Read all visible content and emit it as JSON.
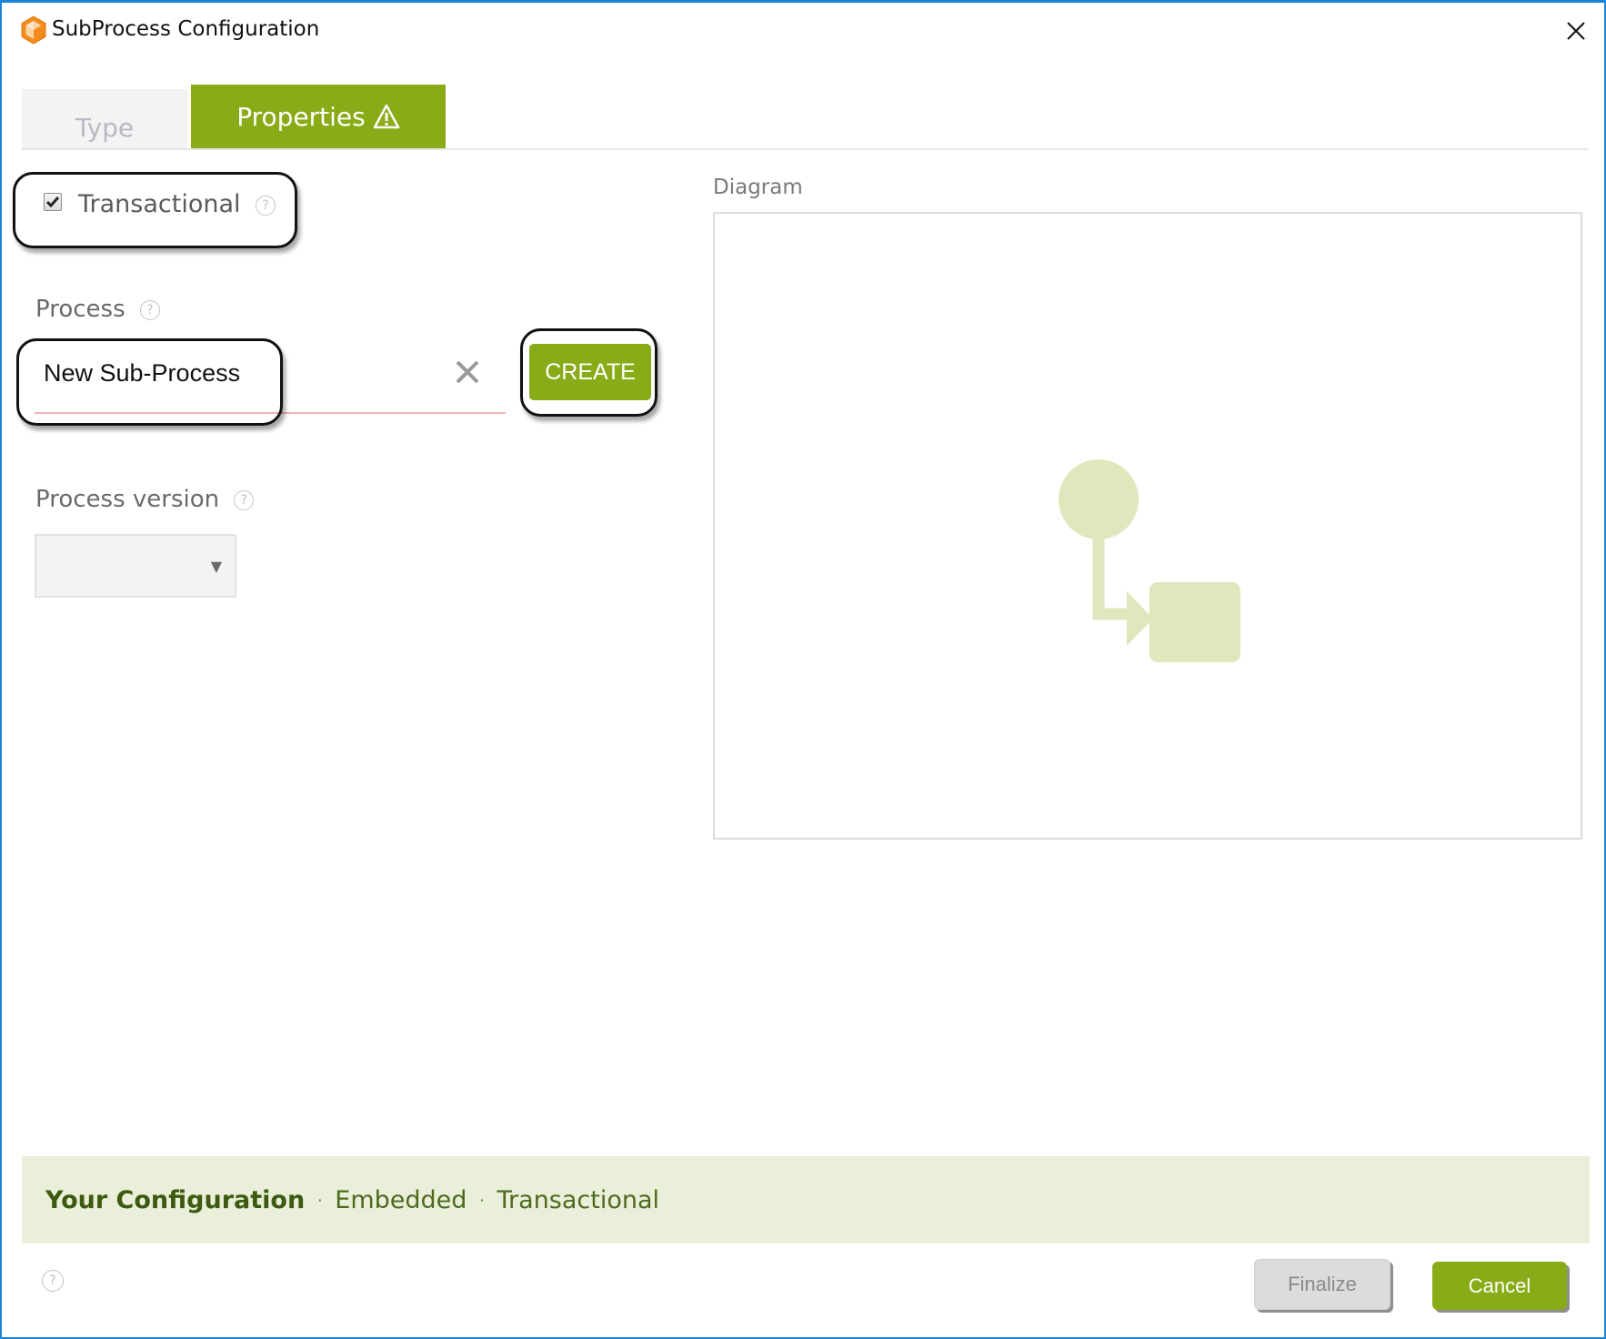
{
  "window": {
    "title": "SubProcess Configuration"
  },
  "tabs": [
    {
      "label": "Type",
      "active": false
    },
    {
      "label": "Properties",
      "active": true,
      "warning": true
    }
  ],
  "form": {
    "transactional": {
      "label": "Transactional",
      "checked": true
    },
    "process": {
      "label": "Process",
      "value": "New Sub-Process",
      "create_label": "CREATE"
    },
    "process_version": {
      "label": "Process version",
      "selected": ""
    }
  },
  "diagram": {
    "label": "Diagram"
  },
  "configuration": {
    "title": "Your Configuration",
    "separator": "·",
    "items": [
      "Embedded",
      "Transactional"
    ]
  },
  "footer": {
    "finalize_label": "Finalize",
    "cancel_label": "Cancel"
  },
  "icons": {
    "help": "?",
    "dropdown_arrow": "▼"
  },
  "colors": {
    "accent": "#8aab18",
    "window_border": "#1a84d8",
    "config_bg": "#e9efd8",
    "diagram_shape": "#dfe7bd",
    "error_underline": "#f2b4b4"
  }
}
